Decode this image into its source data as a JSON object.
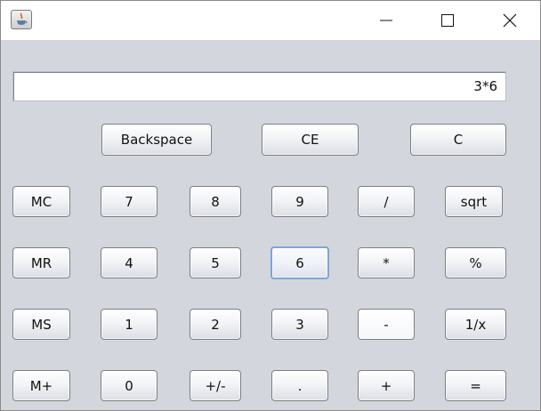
{
  "display": {
    "value": "3*6"
  },
  "window_controls": {
    "minimize_icon": "minimize-icon",
    "maximize_icon": "maximize-icon",
    "close_icon": "close-icon"
  },
  "app_icon": "java-coffee-cup-icon",
  "top_buttons": {
    "backspace": "Backspace",
    "ce": "CE",
    "c": "C"
  },
  "memory_buttons": {
    "mc": "MC",
    "mr": "MR",
    "ms": "MS",
    "mplus": "M+"
  },
  "keys": {
    "seven": "7",
    "eight": "8",
    "nine": "9",
    "divide": "/",
    "sqrt": "sqrt",
    "four": "4",
    "five": "5",
    "six": "6",
    "multiply": "*",
    "percent": "%",
    "one": "1",
    "two": "2",
    "three": "3",
    "minus": "-",
    "reciprocal": "1/x",
    "zero": "0",
    "sign": "+/-",
    "point": ".",
    "plus": "+",
    "equals": "="
  },
  "state": {
    "focused_key": "6",
    "hovered_key": "-"
  },
  "colors": {
    "window_bg": "#d4d6de",
    "focus_border": "#7aa7d9"
  }
}
